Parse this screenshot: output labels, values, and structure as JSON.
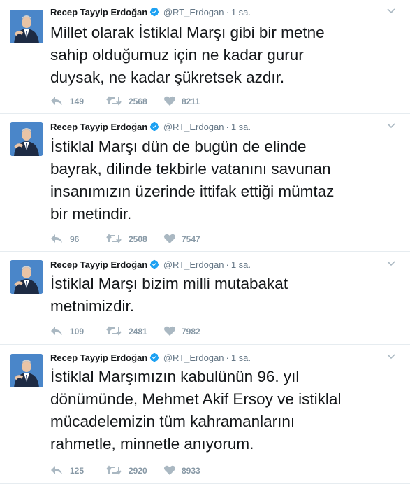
{
  "colors": {
    "verified": "#1da1f2",
    "muted": "#657786",
    "icon": "#aab8c2"
  },
  "tweets": [
    {
      "name": "Recep Tayyip Erdoğan",
      "handle": "@RT_Erdogan",
      "sep": "·",
      "time": "1 sa.",
      "text": "Millet olarak İstiklal Marşı gibi bir metne\nsahip olduğumuz için ne kadar gurur\nduysak, ne kadar şükretsek azdır.",
      "replies": "149",
      "retweets": "2568",
      "likes": "8211"
    },
    {
      "name": "Recep Tayyip Erdoğan",
      "handle": "@RT_Erdogan",
      "sep": "·",
      "time": "1 sa.",
      "text": "İstiklal Marşı dün de bugün de elinde\nbayrak, dilinde tekbirle vatanını savunan\ninsanımızın üzerinde ittifak ettiği mümtaz\nbir metindir.",
      "replies": "96",
      "retweets": "2508",
      "likes": "7547"
    },
    {
      "name": "Recep Tayyip Erdoğan",
      "handle": "@RT_Erdogan",
      "sep": "·",
      "time": "1 sa.",
      "text": "İstiklal Marşı bizim milli mutabakat\nmetnimizdir.",
      "replies": "109",
      "retweets": "2481",
      "likes": "7982"
    },
    {
      "name": "Recep Tayyip Erdoğan",
      "handle": "@RT_Erdogan",
      "sep": "·",
      "time": "1 sa.",
      "text": "İstiklal Marşımızın kabulünün 96. yıl\ndönümünde, Mehmet Akif Ersoy ve istiklal\nmücadelemizin tüm kahramanlarını\nrahmetle, minnetle anıyorum.",
      "replies": "125",
      "retweets": "2920",
      "likes": "8933"
    }
  ]
}
